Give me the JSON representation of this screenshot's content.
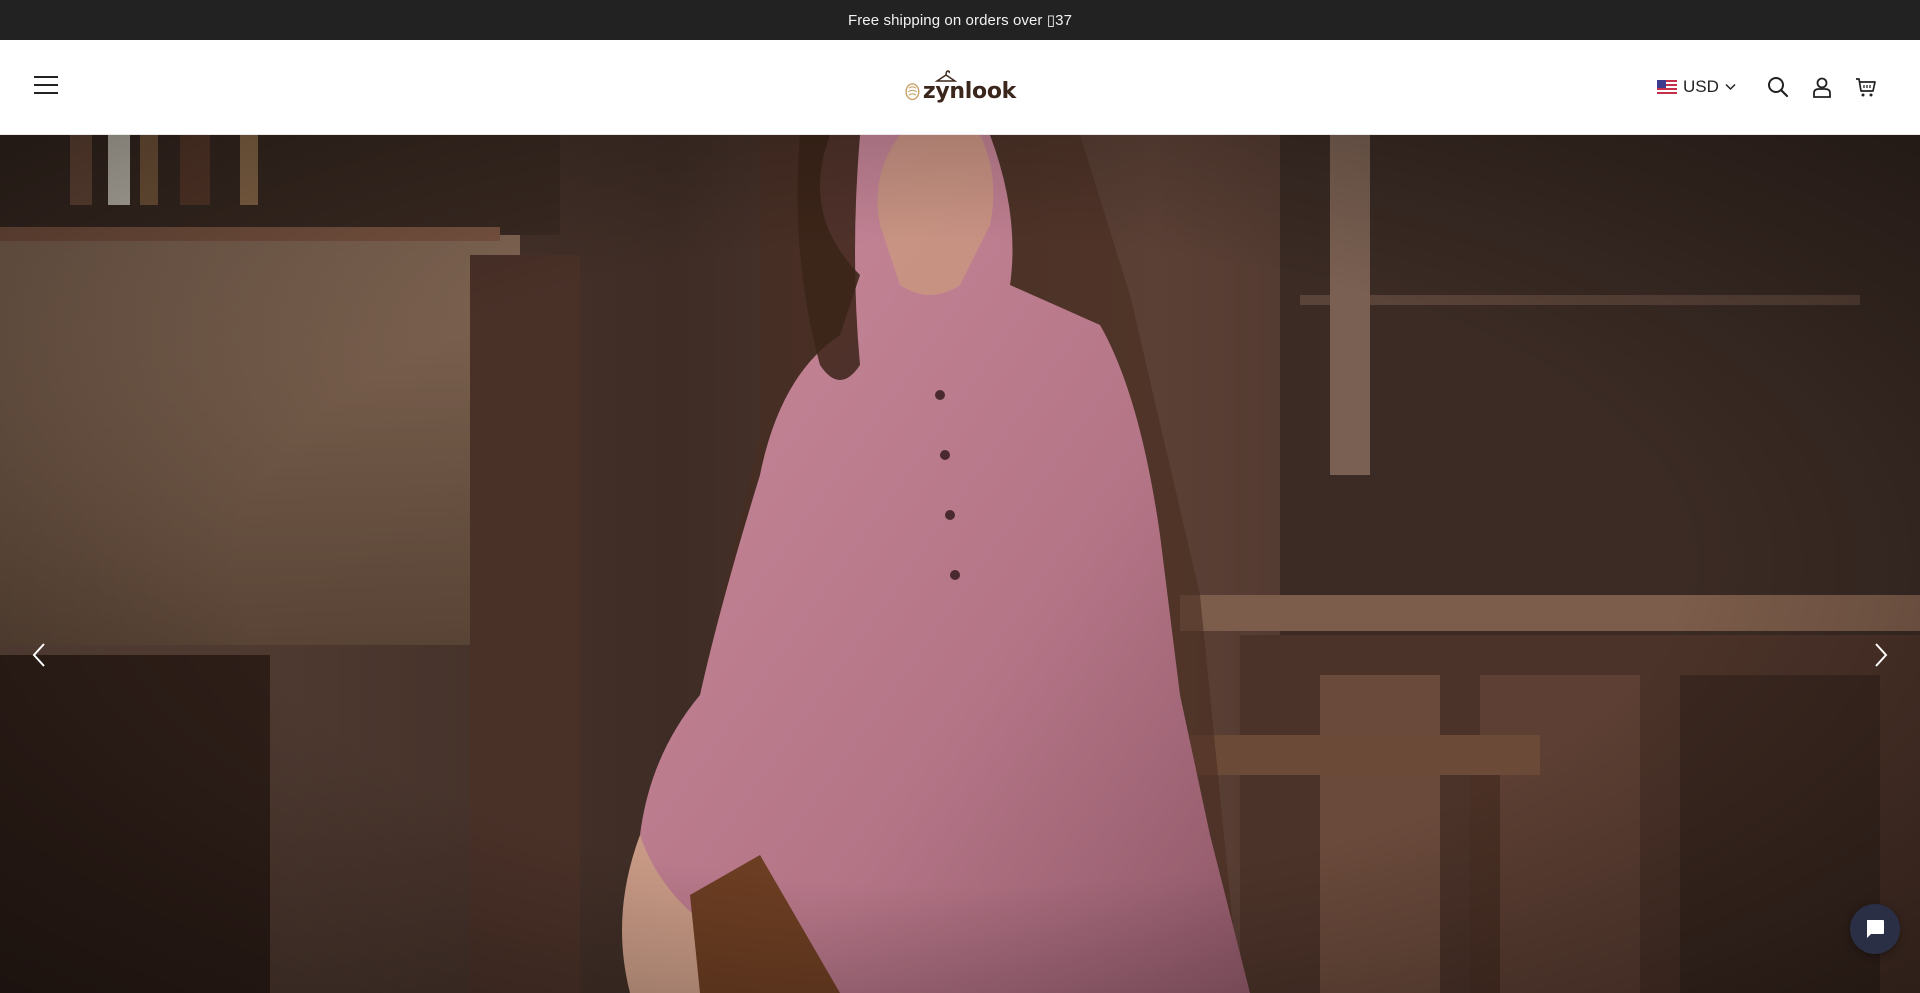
{
  "announcement": {
    "text": "Free shipping on orders over ▯37"
  },
  "header": {
    "logo_text": "zynlook",
    "currency": {
      "code": "USD"
    },
    "icons": [
      "menu-icon",
      "search-icon",
      "account-icon",
      "cart-icon"
    ]
  },
  "hero": {
    "slider_icons": [
      "chevron-left-icon",
      "chevron-right-icon"
    ]
  },
  "chat": {
    "icon": "chat-icon"
  },
  "colors": {
    "announcement_bg": "#222222",
    "header_bg": "#ffffff",
    "logo_color": "#3b261b",
    "chat_bg": "#2a2f45"
  }
}
